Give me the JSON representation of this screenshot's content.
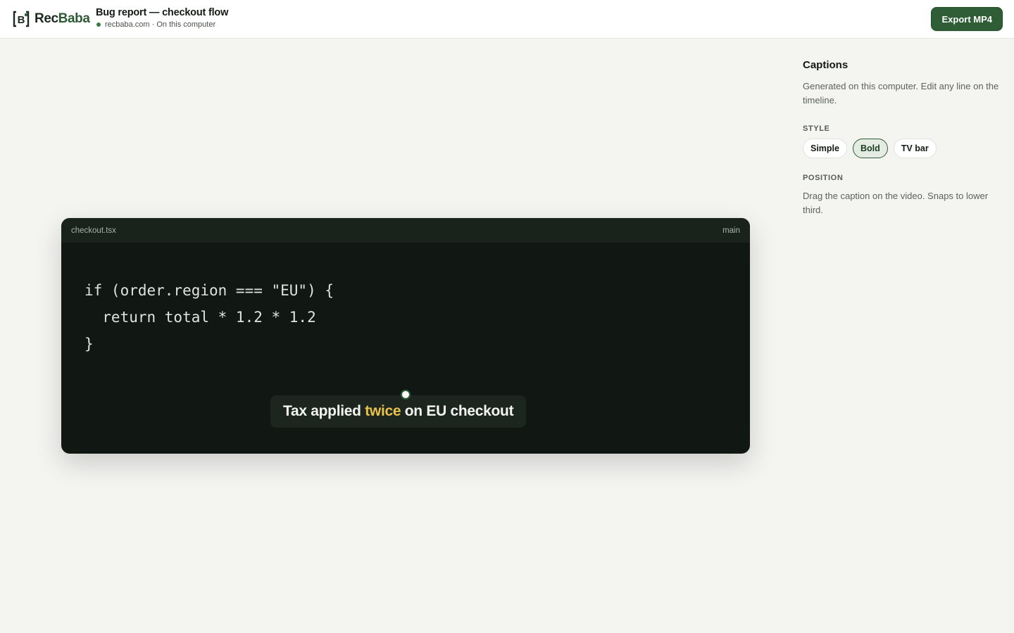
{
  "app": {
    "logo_prefix": "Rec",
    "logo_suffix": "Baba",
    "brand_color": "#2f5d36",
    "accent_color": "#e8c24a"
  },
  "header": {
    "title": "Bug report — checkout flow",
    "subtitle": "recbaba.com · On this computer",
    "export_label": "Export MP4"
  },
  "preview": {
    "filename": "checkout.tsx",
    "branch": "main",
    "code_lines": [
      "if (order.region === \"EU\") {",
      "  return total * 1.2 * 1.2",
      "}"
    ],
    "caption": {
      "before": "Tax applied ",
      "highlight": "twice",
      "after": " on EU checkout"
    }
  },
  "captions_panel": {
    "title": "Captions",
    "description": "Generated on this computer. Edit any line on the timeline.",
    "style_label": "STYLE",
    "styles": [
      {
        "label": "Simple",
        "selected": false
      },
      {
        "label": "Bold",
        "selected": true
      },
      {
        "label": "TV bar",
        "selected": false
      }
    ],
    "position_label": "POSITION",
    "position_description": "Drag the caption on the video. Snaps to lower third."
  }
}
